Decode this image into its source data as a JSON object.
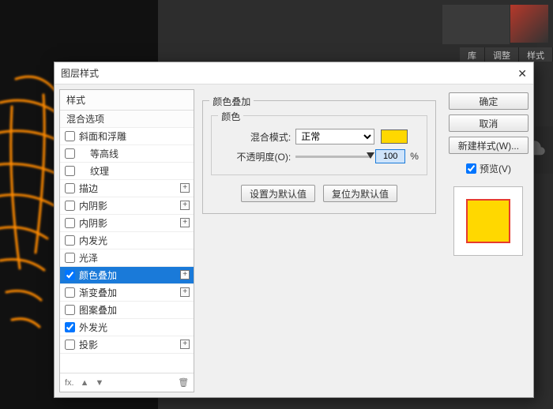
{
  "panel_tabs": {
    "lib": "库",
    "adjust": "调整",
    "style": "样式"
  },
  "dialog": {
    "title": "图层样式",
    "close_glyph": "✕",
    "styles_header": "样式",
    "blend_options": "混合选项",
    "items": {
      "bevel": "斜面和浮雕",
      "contour": "等高线",
      "texture": "纹理",
      "stroke": "描边",
      "inner_shadow": "内阴影",
      "inner_shadow2": "内阴影",
      "inner_glow": "内发光",
      "satin": "光泽",
      "color_overlay": "颜色叠加",
      "gradient_overlay": "渐变叠加",
      "pattern_overlay": "图案叠加",
      "outer_glow": "外发光",
      "drop_shadow": "投影"
    },
    "footer": {
      "fx": "fx.",
      "up": "▲",
      "down": "▼",
      "trash": "🗑"
    },
    "settings": {
      "group_title": "颜色叠加",
      "subgroup_title": "颜色",
      "blend_mode_label": "混合模式:",
      "blend_mode_value": "正常",
      "opacity_label": "不透明度(O):",
      "opacity_value": "100",
      "percent": "%",
      "make_default": "设置为默认值",
      "reset_default": "复位为默认值",
      "swatch_color": "#ffd800"
    },
    "buttons": {
      "ok": "确定",
      "cancel": "取消",
      "new_style": "新建样式(W)...",
      "preview": "预览(V)"
    },
    "preview_swatch": {
      "fill": "#ffd800",
      "border": "#e63b2e"
    }
  }
}
